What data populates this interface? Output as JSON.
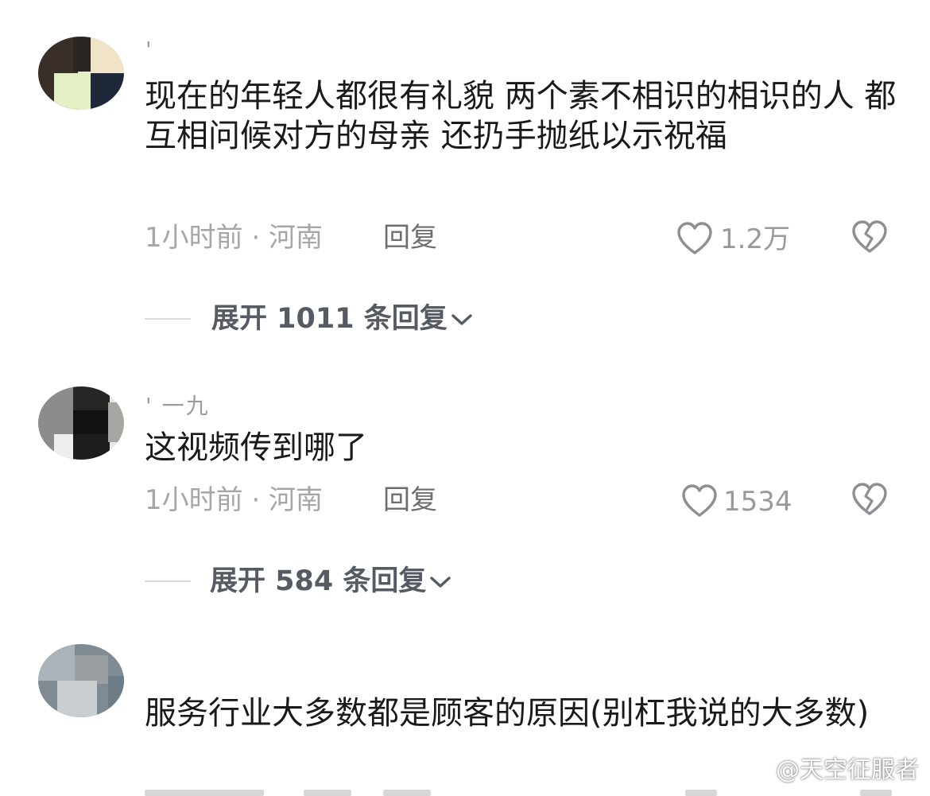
{
  "comments": [
    {
      "username": "' ",
      "text": "现在的年轻人都很有礼貌 两个素不相识的相识的人 都互相问候对方的母亲 还扔手抛纸以示祝福",
      "time_location": "1小时前 · 河南",
      "reply_label": "回复",
      "likes": "1.2万",
      "expand_label": "展开 1011 条回复"
    },
    {
      "username": "' 一九",
      "text": "这视频传到哪了",
      "time_location": "1小时前 · 河南",
      "reply_label": "回复",
      "likes": "1534",
      "expand_label": "展开 584 条回复"
    },
    {
      "username": "",
      "text": "服务行业大多数都是顾客的原因(别杠我说的大多数)"
    }
  ],
  "watermark": "@天空征服者",
  "icons": {
    "like": "heart-outline-icon",
    "dislike": "broken-heart-icon",
    "expand": "chevron-down-icon",
    "watermark": "weibo-logo-icon"
  },
  "colors": {
    "body_text": "#1a1a1a",
    "meta_text": "#a6a6a6",
    "reply_text": "#6e6e6e",
    "expand_text": "#555a63",
    "icon_stroke": "#8e8e93",
    "background": "#ffffff"
  }
}
